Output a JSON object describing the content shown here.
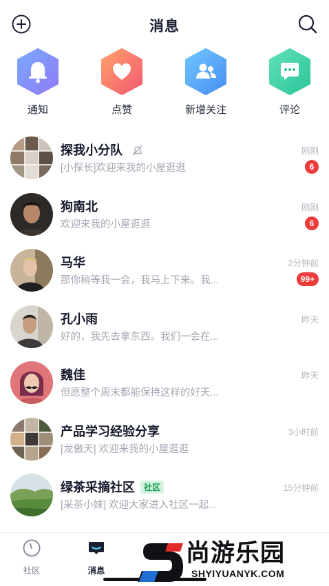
{
  "header": {
    "title": "消息"
  },
  "quick_actions": [
    {
      "label": "通知",
      "icon": "bell-icon",
      "color_from": "#7aa7ff",
      "color_to": "#8f7cf5"
    },
    {
      "label": "点赞",
      "icon": "heart-icon",
      "color_from": "#ffa06b",
      "color_to": "#f35a72"
    },
    {
      "label": "新增关注",
      "icon": "users-icon",
      "color_from": "#6ec6ff",
      "color_to": "#4a8ef2"
    },
    {
      "label": "评论",
      "icon": "comment-icon",
      "color_from": "#5fe0b9",
      "color_to": "#2dc59b"
    }
  ],
  "conversations": [
    {
      "name": "探我小分队",
      "preview": "[小探长]欢迎来我的小屋逛逛",
      "time": "刚刚",
      "badge": "6",
      "muted": true
    },
    {
      "name": "狗南北",
      "preview": "欢迎来我的小屋逛逛",
      "time": "刚刚",
      "badge": "6"
    },
    {
      "name": "马华",
      "preview": "那你稍等我一会，我马上下来。我...",
      "time": "2分钟前",
      "badge": "99+"
    },
    {
      "name": "孔小雨",
      "preview": "好的，我先去拿东西。我们一会在...",
      "time": "昨天"
    },
    {
      "name": "魏佳",
      "preview": "但愿整个周末都能保持这样的好天...",
      "time": "昨天"
    },
    {
      "name": "产品学习经验分享",
      "preview": "[龙傲天] 欢迎来我的小屋逛逛",
      "time": "3小时前"
    },
    {
      "name": "绿茶采摘社区",
      "tag": "社区",
      "preview": "[采茶小妹] 欢迎大家进入社区一起...",
      "time": "15分钟前"
    }
  ],
  "tabbar": {
    "community": "社区",
    "messages": "消息"
  },
  "watermark": {
    "cn": "尚游乐园",
    "en": "SHYIYUANYK.COM"
  },
  "colors": {
    "badge": "#ec3b3b",
    "tag_text": "#1a9c57",
    "tag_bg": "#d6f3e2"
  }
}
